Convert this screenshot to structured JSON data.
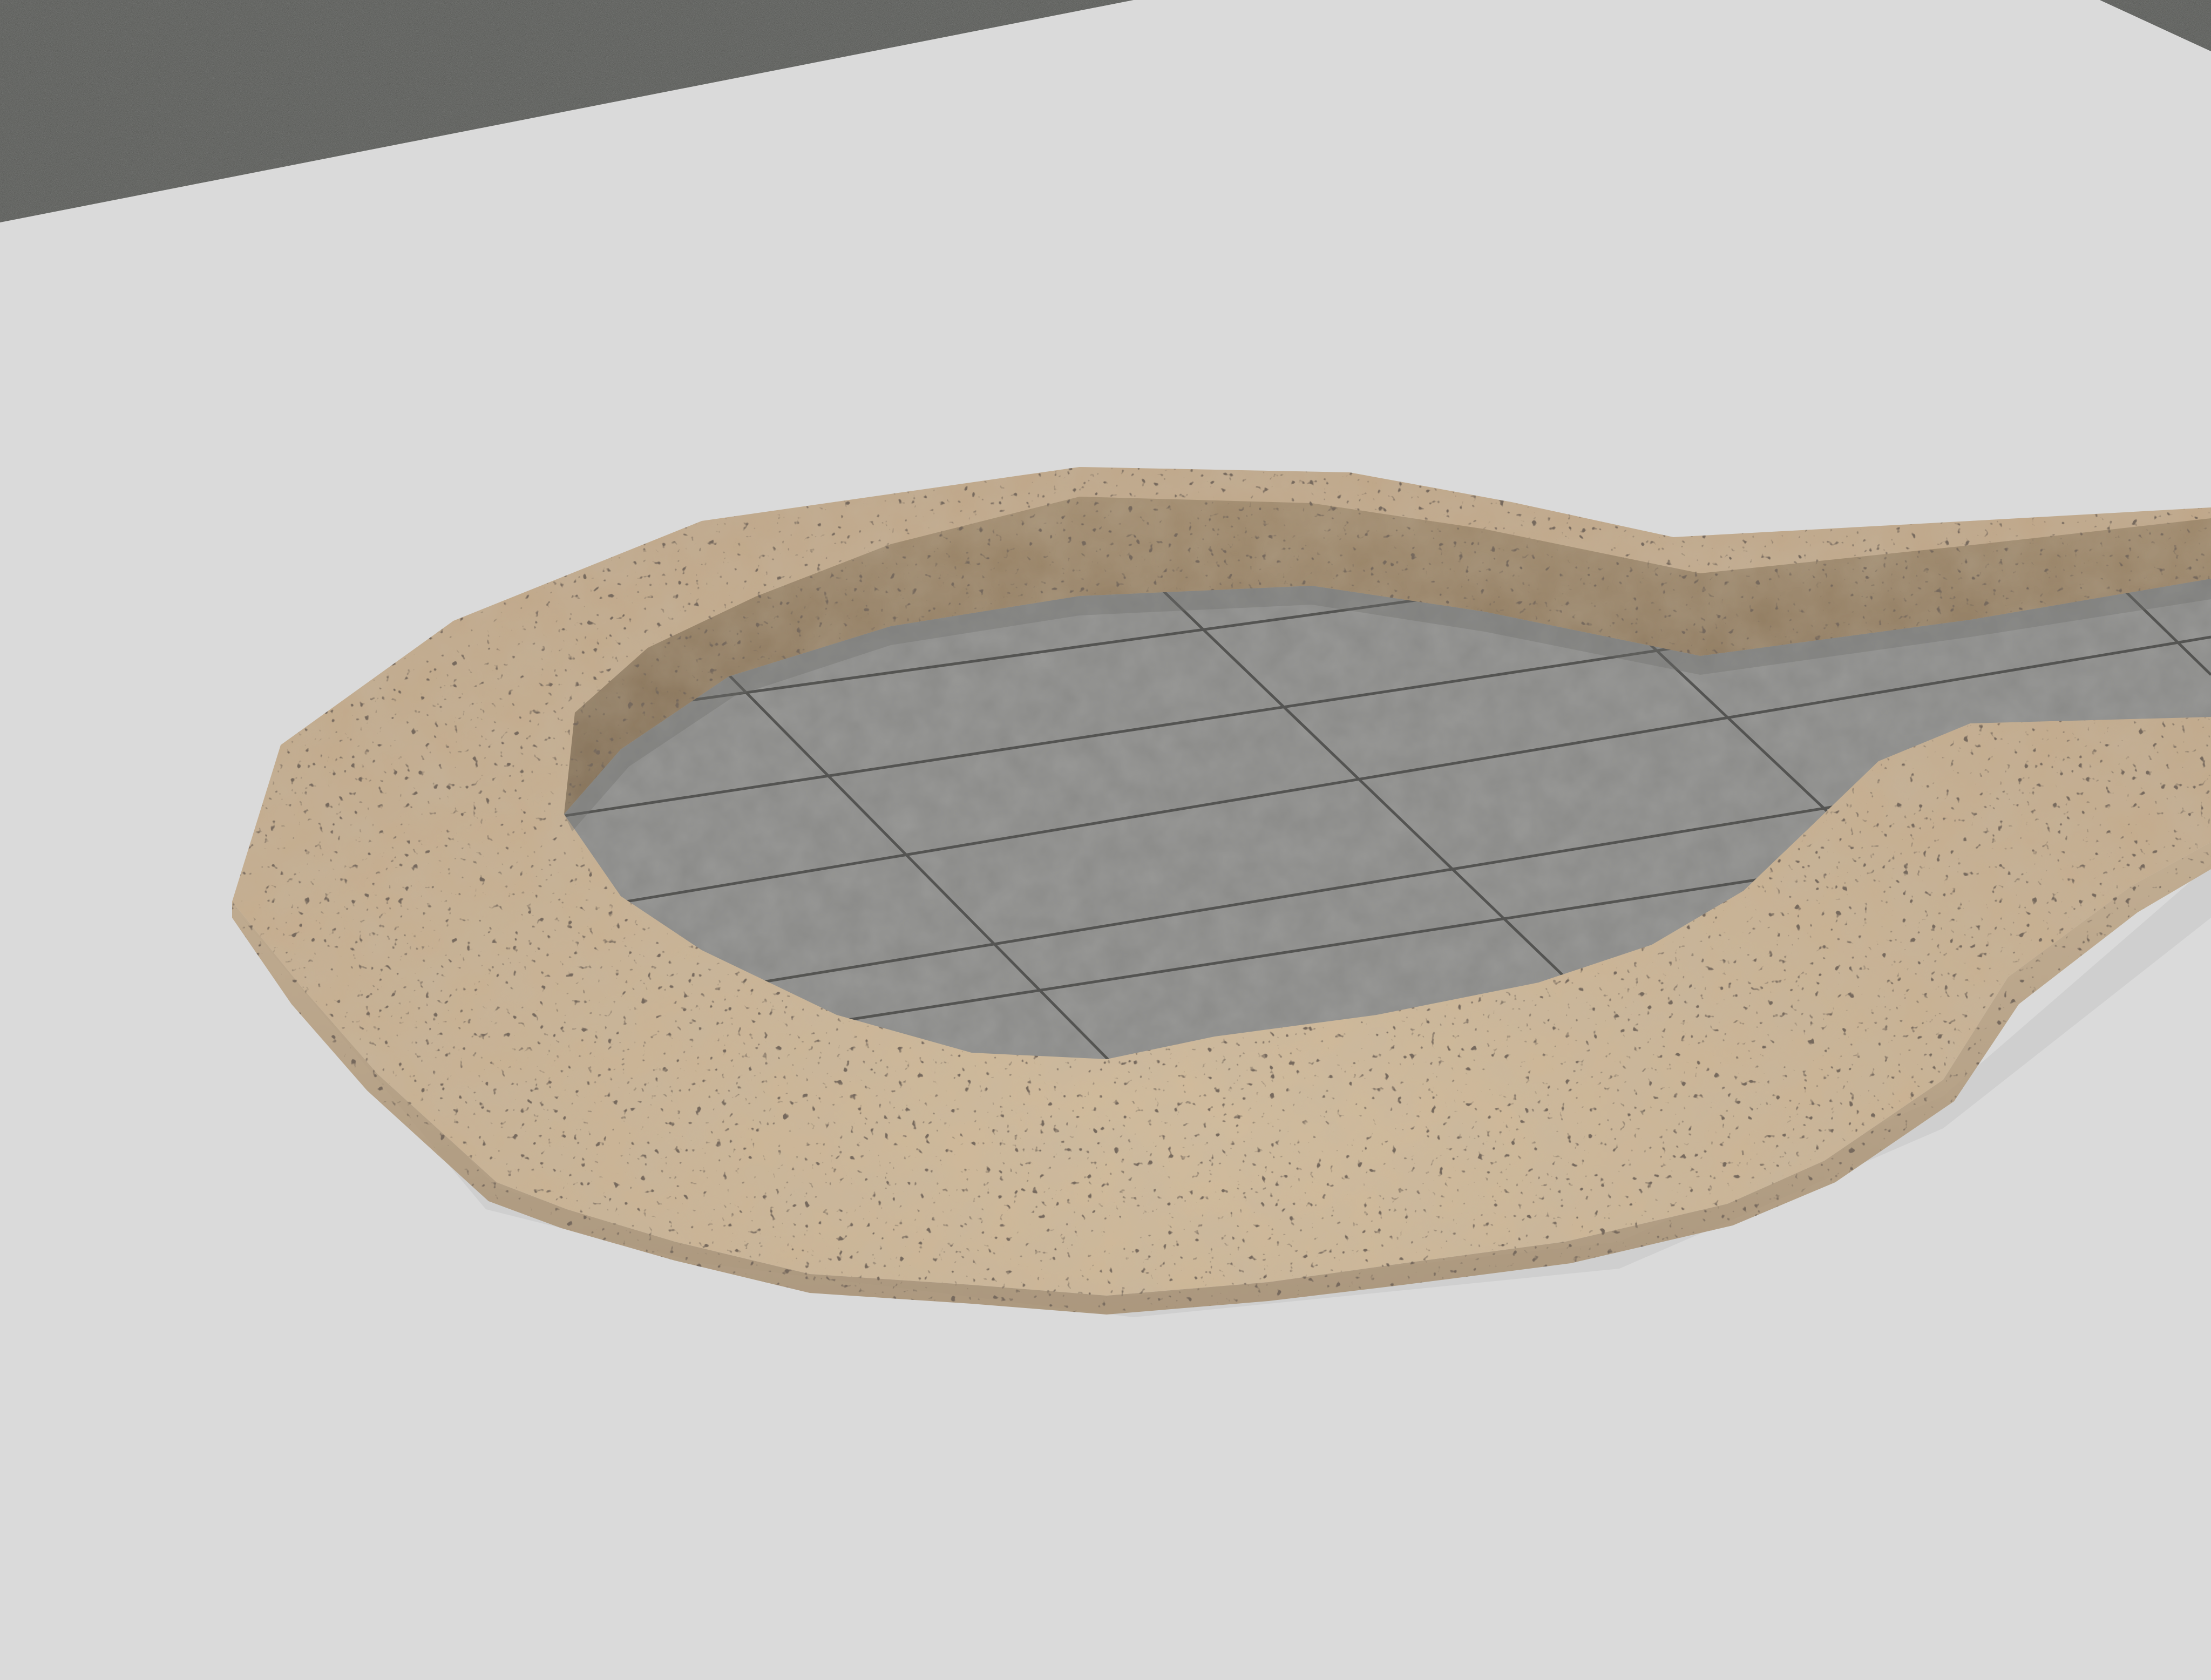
{
  "scene": {
    "background_color": "#dcdcdc",
    "ground_plane_color": "#dadada",
    "asphalt_color": "#535451",
    "stone_rim_color": "#c4ad8e",
    "stone_rim_shadow_color": "#9c8669",
    "stone_pore_color": "#3a2e24",
    "paved_floor_color": "#8a8a88",
    "paving_joint_color": "#4a4a48",
    "objects": [
      {
        "name": "asphalt-road",
        "material": "asphalt"
      },
      {
        "name": "ground-plane",
        "material": "flat-grey"
      },
      {
        "name": "stone-pool-rim",
        "material": "travertine-stone"
      },
      {
        "name": "paved-pool-floor",
        "material": "concrete-tiles"
      }
    ]
  }
}
